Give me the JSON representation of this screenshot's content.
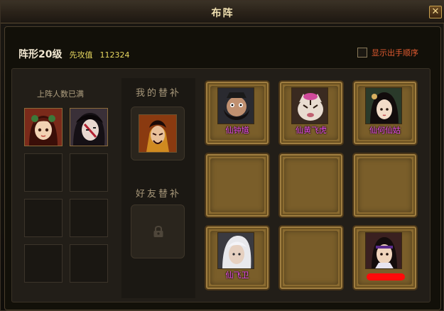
{
  "window": {
    "title": "布阵",
    "close_label": "✕"
  },
  "header": {
    "formation_level": "阵形20级",
    "attack_label": "先攻值",
    "attack_value": "112324"
  },
  "order_toggle": {
    "label": "显示出手顺序",
    "checked": false
  },
  "lineup": {
    "status": "上阵人数已满"
  },
  "substitutes": {
    "my_title": "我的替补",
    "friend_title": "好友替补"
  },
  "grid": [
    {
      "name": "仙钟馗"
    },
    {
      "name": "仙黄飞虎"
    },
    {
      "name": "仙何仙姑"
    },
    {
      "name": ""
    },
    {
      "name": ""
    },
    {
      "name": ""
    },
    {
      "name": "仙飞卫"
    },
    {
      "name": ""
    },
    {
      "name": ""
    }
  ],
  "colors": {
    "name_text": "#f050f0",
    "attack_text": "#e8d860",
    "order_text": "#e05a30"
  }
}
